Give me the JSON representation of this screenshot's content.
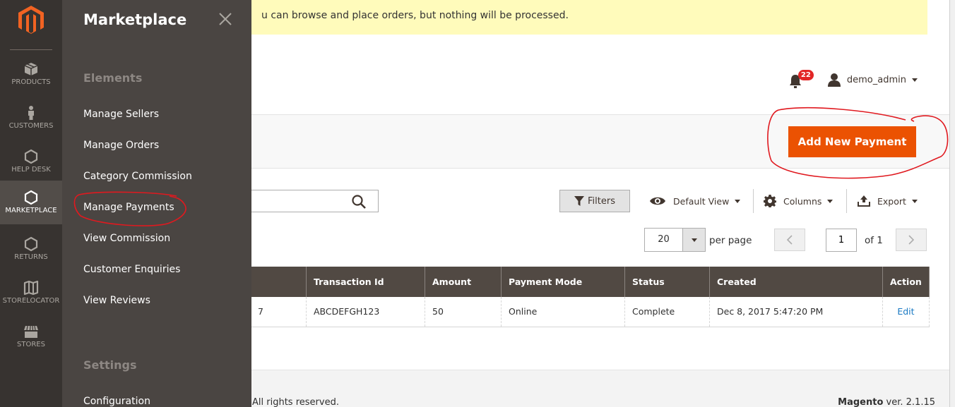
{
  "nav": {
    "items": [
      {
        "label": "PRODUCTS",
        "icon": "box-icon"
      },
      {
        "label": "CUSTOMERS",
        "icon": "person-icon"
      },
      {
        "label": "HELP DESK",
        "icon": "hexagon-icon"
      },
      {
        "label": "MARKETPLACE",
        "icon": "hexagon-icon",
        "active": true
      },
      {
        "label": "RETURNS",
        "icon": "hexagon-icon"
      },
      {
        "label": "STORELOCATOR",
        "icon": "map-icon"
      },
      {
        "label": "STORES",
        "icon": "storefront-icon"
      }
    ]
  },
  "flyout": {
    "title": "Marketplace",
    "sections": [
      {
        "title": "Elements",
        "links": [
          "Manage Sellers",
          "Manage Orders",
          "Category Commission",
          "Manage Payments",
          "View Commission",
          "Customer Enquiries",
          "View Reviews"
        ]
      },
      {
        "title": "Settings",
        "links": [
          "Configuration"
        ]
      }
    ]
  },
  "notice": {
    "text": "u can browse and place orders, but nothing will be processed."
  },
  "header": {
    "notifications_count": "22",
    "username": "demo_admin"
  },
  "page_actions": {
    "add_button": "Add New Payment"
  },
  "toolbar": {
    "search_placeholder": "",
    "filters": "Filters",
    "view": "Default View",
    "columns": "Columns",
    "export": "Export",
    "per_page_value": "20",
    "per_page_label": "per page",
    "current_page": "1",
    "of_pages": "of 1"
  },
  "grid": {
    "columns": [
      "",
      "Transaction Id",
      "Amount",
      "Payment Mode",
      "Status",
      "Created",
      "Action"
    ],
    "rows": [
      [
        "7",
        "ABCDEFGH123",
        "50",
        "Online",
        "Complete",
        "Dec 8, 2017 5:47:20 PM",
        "Edit"
      ]
    ]
  },
  "footer": {
    "copyright": "All rights reserved.",
    "brand": "Magento",
    "version": " ver. 2.1.15"
  },
  "colors": {
    "accent": "#eb5202",
    "nav_bg": "#373330",
    "flyout_bg": "#4a4542",
    "table_header": "#514943",
    "link": "#1979c3",
    "notice_bg": "#fffbbb",
    "badge": "#e22626",
    "annotation": "#e0191f"
  }
}
